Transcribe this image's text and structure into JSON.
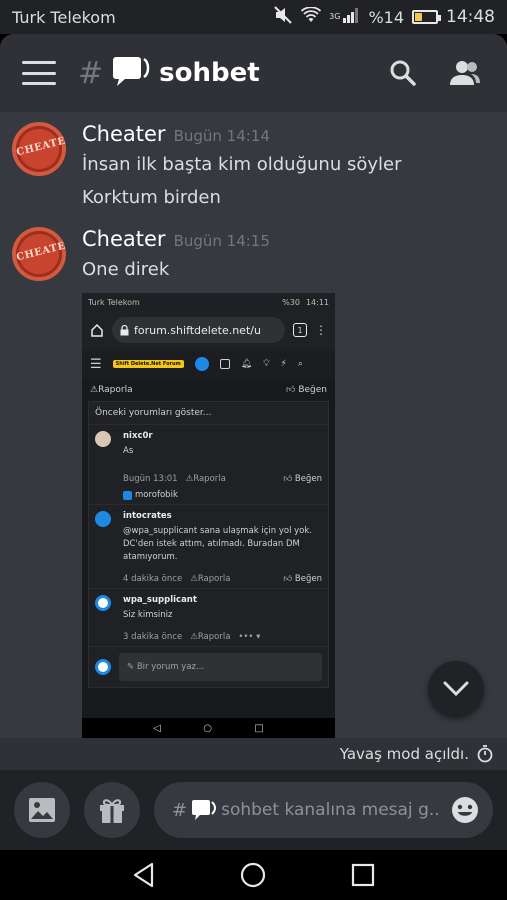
{
  "status_bar": {
    "carrier": "Turk Telekom",
    "network": "3G",
    "battery": "%14",
    "time": "14:48"
  },
  "header": {
    "hash": "#",
    "channel_name": "sohbet"
  },
  "messages": [
    {
      "author": "Cheater",
      "time": "Bugün 14:14",
      "lines": [
        "İnsan ilk başta kim olduğunu söyler",
        "Korktum birden"
      ]
    },
    {
      "author": "Cheater",
      "time": "Bugün 14:15",
      "lines": [
        "One direk"
      ]
    }
  ],
  "avatar_stamp": "CHEATER",
  "attachment": {
    "status": {
      "carrier": "Turk Telekom",
      "battery": "%30",
      "time": "14:11"
    },
    "url": "forum.shiftdelete.net/u",
    "tab_count": "1",
    "logo": "Shift Delete.Net Forum",
    "top_actions": {
      "report": "Raporla",
      "like": "Beğen"
    },
    "show_previous": "Önceki yorumları göster...",
    "comments": [
      {
        "name": "nixc0r",
        "text": "As",
        "time": "Bugün 13:01",
        "report": "Raporla",
        "like": "Beğen",
        "reactor": "morofobik"
      },
      {
        "name": "intocrates",
        "text": "@wpa_supplicant sana ulaşmak için yol yok. DC'den istek attım, atılmadı. Buradan DM atamıyorum.",
        "time": "4 dakika önce",
        "report": "Raporla",
        "like": "Beğen"
      },
      {
        "name": "wpa_supplicant",
        "text": "Siz kimsiniz",
        "time": "3 dakika önce",
        "report": "Raporla",
        "more": "••• ▾"
      }
    ],
    "comment_placeholder": "Bir yorum yaz..."
  },
  "slowmode_text": "Yavaş mod açıldı.",
  "composer": {
    "hash": "#",
    "placeholder": "sohbet kanalına mesaj g..."
  },
  "colors": {
    "background": "#36393f",
    "header": "#2f3136",
    "composer": "#202225",
    "accent_blue": "#1e88e5"
  }
}
